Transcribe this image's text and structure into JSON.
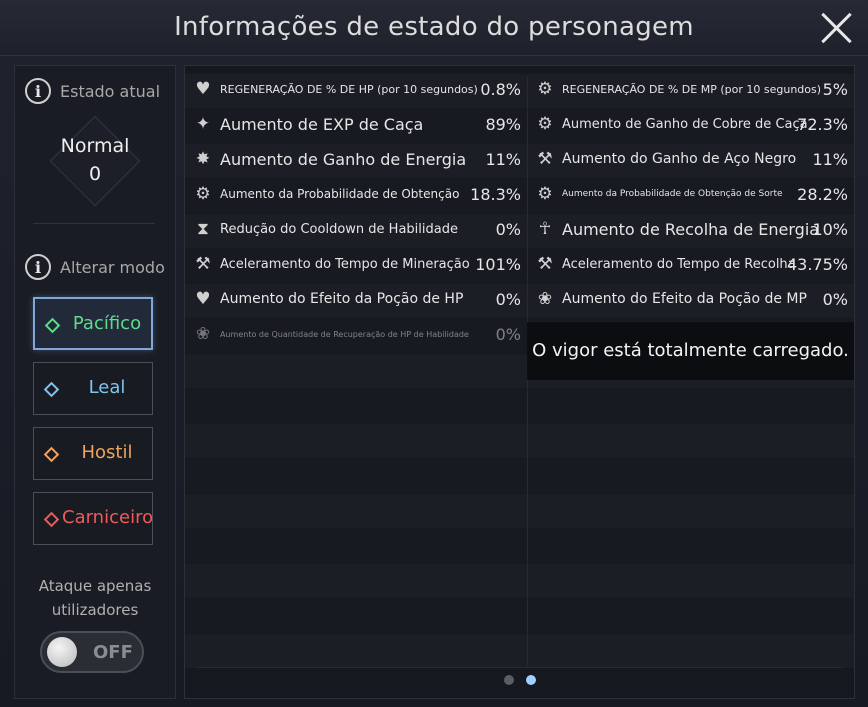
{
  "title": "Informações de estado do personagem",
  "left": {
    "current_state_label": "Estado atual",
    "state_name": "Normal",
    "state_value": "0",
    "change_mode_label": "Alterar modo",
    "modes": [
      {
        "label": "Pacífico",
        "color": "#5fdc8a",
        "selected": true
      },
      {
        "label": "Leal",
        "color": "#7ec4f0",
        "selected": false
      },
      {
        "label": "Hostil",
        "color": "#f0a35a",
        "selected": false
      },
      {
        "label": "Carniceiro",
        "color": "#ef5a5a",
        "selected": false
      }
    ],
    "attack_line1": "Ataque apenas",
    "attack_line2": "utilizadores",
    "toggle_label": "OFF"
  },
  "stats_left": [
    {
      "icon": "hp-regen-icon",
      "label": "REGENERAÇÃO DE % DE HP (por 10 segundos)",
      "value": "0.8%"
    },
    {
      "icon": "exp-icon",
      "label": "Aumento de EXP de Caça",
      "value": "89%"
    },
    {
      "icon": "energy-icon",
      "label": "Aumento de Ganho de Energia",
      "value": "11%"
    },
    {
      "icon": "drop-rate-icon",
      "label": "Aumento da Probabilidade de Obtenção",
      "value": "18.3%"
    },
    {
      "icon": "hourglass-icon",
      "label": "Redução do Cooldown de Habilidade",
      "value": "0%"
    },
    {
      "icon": "pickaxe-icon",
      "label": "Aceleramento do Tempo de Mineração",
      "value": "101%"
    },
    {
      "icon": "hp-potion-icon",
      "label": "Aumento do Efeito da Poção de HP",
      "value": "0%"
    },
    {
      "icon": "skill-hp-icon",
      "label": "Aumento de Quantidade de Recuperação de HP de Habilidade",
      "value": "0%"
    }
  ],
  "stats_right": [
    {
      "icon": "mp-regen-icon",
      "label": "REGENERAÇÃO DE % DE MP (por 10 segundos)",
      "value": "5%"
    },
    {
      "icon": "copper-icon",
      "label": "Aumento de Ganho de Cobre de Caça",
      "value": "72.3%"
    },
    {
      "icon": "black-steel-icon",
      "label": "Aumento do Ganho de Aço Negro",
      "value": "11%"
    },
    {
      "icon": "luck-icon",
      "label": "Aumento da Probabilidade de Obtenção de Sorte",
      "value": "28.2%"
    },
    {
      "icon": "meditate-icon",
      "label": "Aumento de Recolha de Energia",
      "value": "10%"
    },
    {
      "icon": "gather-icon",
      "label": "Aceleramento do Tempo de Recolha",
      "value": "43.75%"
    },
    {
      "icon": "mp-potion-icon",
      "label": "Aumento do Efeito da Poção de MP",
      "value": "0%"
    }
  ],
  "toast": "O vigor está totalmente carregado.",
  "pages": {
    "count": 2,
    "current": 2
  }
}
